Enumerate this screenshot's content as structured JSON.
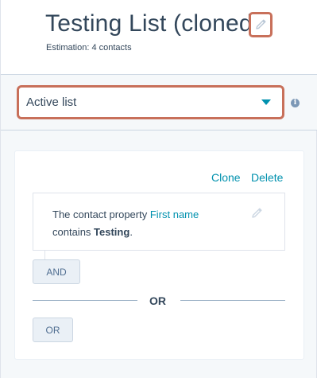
{
  "header": {
    "title": "Testing List (cloned)",
    "estimation": "Estimation: 4 contacts"
  },
  "list_type": {
    "selected": "Active list",
    "options_visible": [
      "Active list"
    ]
  },
  "filter_group": {
    "clone_label": "Clone",
    "delete_label": "Delete",
    "filter": {
      "prefix": "The contact property ",
      "property": "First name",
      "operator": "contains ",
      "value": "Testing",
      "suffix": "."
    },
    "and_label": "AND"
  },
  "divider": {
    "or_label": "OR"
  },
  "or_button_label": "OR",
  "colors": {
    "accent": "#0091ae",
    "text": "#33475b",
    "highlight_outline": "#c8705a",
    "button_bg": "#eaf0f6"
  },
  "icons": {
    "edit": "pencil-icon",
    "dropdown": "caret-down-icon",
    "info": "info-icon"
  }
}
